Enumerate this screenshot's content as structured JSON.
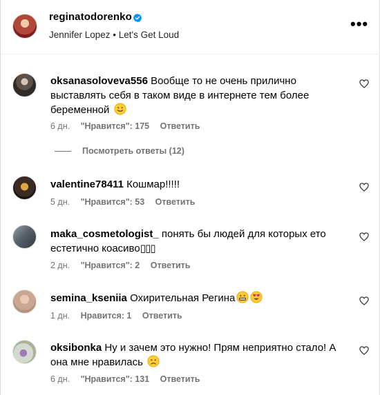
{
  "post": {
    "username": "reginatodorenko",
    "audio": "Jennifer Lopez • Let's Get Loud"
  },
  "comments": [
    {
      "username": "oksanasoloveva556",
      "text": "Вообще то не очень прилично выставлять себя в таком виде в интернете тем более беременной",
      "emoji": "slightly-smiling-face",
      "time": "6 дн.",
      "likes": "\"Нравится\": 175",
      "reply": "Ответить",
      "view_replies": "Посмотреть ответы (12)"
    },
    {
      "username": "valentine78411",
      "text": "Кошмар!!!!!",
      "time": "5 дн.",
      "likes": "\"Нравится\": 53",
      "reply": "Ответить"
    },
    {
      "username": "maka_cosmetologist_",
      "text": "понять бы людей для которых ето естетично коасиво",
      "trailing": "▯▯▯",
      "time": "2 дн.",
      "likes": "\"Нравится\": 2",
      "reply": "Ответить"
    },
    {
      "username": "semina_kseniia",
      "text": "Охирительная Регина",
      "emoji": "grimacing-face, heart-eyes-face",
      "time": "1 дн.",
      "likes": "Нравится: 1",
      "reply": "Ответить"
    },
    {
      "username": "oksibonka",
      "text": "Ну и зачем это нужно! Прям неприятно стало! А она мне нравилась",
      "emoji": "sad-face",
      "time": "6 дн.",
      "likes": "\"Нравится\": 131",
      "reply": "Ответить"
    }
  ],
  "icons": {
    "verified": "verified-badge-icon",
    "more": "more-options-icon",
    "like": "heart-outline-icon"
  },
  "colors": {
    "verified": "#0095f6",
    "secondary_text": "#737373",
    "emoji_yellow": "#ffcc33"
  }
}
